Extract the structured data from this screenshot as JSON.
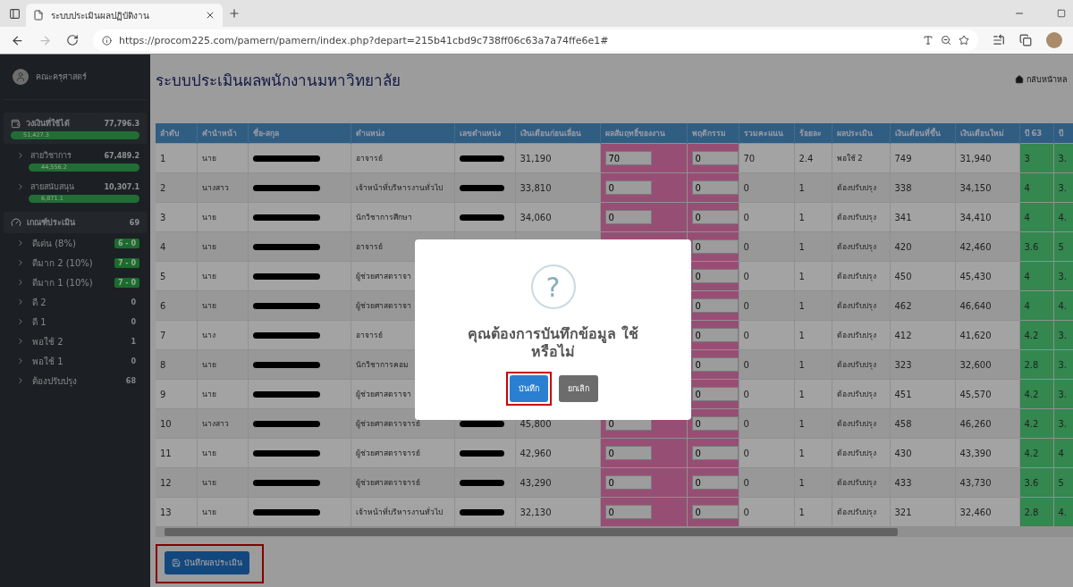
{
  "browser": {
    "tab_title": "ระบบประเมินผลปฏิบัติงาน",
    "url": "https://procom225.com/pamern/pamern/index.php?depart=215b41cbd9c738ff06c63a7a74ffe6e1#"
  },
  "sidebar": {
    "user": "คณะครุศาสตร์",
    "budget": {
      "label": "วงเงินที่ใช้ได้",
      "total": "77,796.3",
      "used": "51,427.3",
      "children": [
        {
          "label": "สายวิชาการ",
          "total": "67,489.2",
          "used": "44,556.2"
        },
        {
          "label": "สายสนับสนุน",
          "total": "10,307.1",
          "used": "6,871.1"
        }
      ]
    },
    "criteria": {
      "label": "เกณฑ์ประเมิน",
      "count": "69",
      "items": [
        {
          "label": "ดีเด่น (8%)",
          "count": "6 - 0",
          "kind": "badge"
        },
        {
          "label": "ดีมาก 2 (10%)",
          "count": "7 - 0",
          "kind": "badge"
        },
        {
          "label": "ดีมาก 1 (10%)",
          "count": "7 - 0",
          "kind": "badge"
        },
        {
          "label": "ดี 2",
          "count": "0",
          "kind": "plain"
        },
        {
          "label": "ดี 1",
          "count": "0",
          "kind": "plain"
        },
        {
          "label": "พอใช้ 2",
          "count": "1",
          "kind": "plain"
        },
        {
          "label": "พอใช้ 1",
          "count": "0",
          "kind": "plain"
        },
        {
          "label": "ต้องปรับปรุง",
          "count": "68",
          "kind": "plain"
        }
      ]
    }
  },
  "header": {
    "title": "ระบบประเมินผลพนักงานมหาวิทยาลัย",
    "back_link": "กลับหน้าหล"
  },
  "table": {
    "columns": [
      {
        "label": "ลำดับ",
        "kind": "text"
      },
      {
        "label": "คำนำหน้า",
        "kind": "text"
      },
      {
        "label": "ชื่อ-สกุล",
        "kind": "redacted"
      },
      {
        "label": "ตำแหน่ง",
        "kind": "text"
      },
      {
        "label": "เลขตำแหน่ง",
        "kind": "redacted"
      },
      {
        "label": "เงินเดือนก่อนเลื่อน",
        "kind": "text"
      },
      {
        "label": "ผลสัมฤทธิ์ของงาน",
        "kind": "input"
      },
      {
        "label": "พฤติกรรม",
        "kind": "input"
      },
      {
        "label": "รวมคะแนน",
        "kind": "text"
      },
      {
        "label": "ร้อยละ",
        "kind": "text"
      },
      {
        "label": "ผลประเมิน",
        "kind": "text"
      },
      {
        "label": "เงินเดือนที่ขึ้น",
        "kind": "text"
      },
      {
        "label": "เงินเดือนใหม่",
        "kind": "text"
      },
      {
        "label": "ปี 63",
        "kind": "year"
      },
      {
        "label": "ปี",
        "kind": "year"
      }
    ],
    "rows": [
      {
        "cells": [
          "1",
          "นาย",
          true,
          "อาจารย์",
          true,
          "31,190",
          "70",
          "0",
          "70",
          "2.4",
          "พอใช้ 2",
          "749",
          "31,940",
          "3",
          "3."
        ]
      },
      {
        "cells": [
          "2",
          "นางสาว",
          true,
          "เจ้าหน้าที่บริหารงานทั่วไป",
          true,
          "33,810",
          "0",
          "0",
          "0",
          "1",
          "ต้องปรับปรุง",
          "338",
          "34,150",
          "4",
          "3."
        ]
      },
      {
        "cells": [
          "3",
          "นาย",
          true,
          "นักวิชาการศึกษา",
          true,
          "34,060",
          "0",
          "0",
          "0",
          "1",
          "ต้องปรับปรุง",
          "341",
          "34,410",
          "4",
          "4."
        ]
      },
      {
        "cells": [
          "4",
          "นาย",
          true,
          "อาจารย์",
          false,
          null,
          null,
          "0",
          "0",
          "1",
          "ต้องปรับปรุง",
          "420",
          "42,460",
          "3.6",
          "5"
        ]
      },
      {
        "cells": [
          "5",
          "นาย",
          true,
          "ผู้ช่วยศาสตราจา",
          false,
          null,
          null,
          "0",
          "0",
          "1",
          "ต้องปรับปรุง",
          "450",
          "45,430",
          "4",
          "3."
        ]
      },
      {
        "cells": [
          "6",
          "นาย",
          true,
          "ผู้ช่วยศาสตราจา",
          false,
          null,
          null,
          "0",
          "0",
          "1",
          "ต้องปรับปรุง",
          "462",
          "46,640",
          "4",
          "4."
        ]
      },
      {
        "cells": [
          "7",
          "นาง",
          true,
          "อาจารย์",
          false,
          null,
          null,
          "0",
          "0",
          "1",
          "ต้องปรับปรุง",
          "412",
          "41,620",
          "4.2",
          "3."
        ]
      },
      {
        "cells": [
          "8",
          "นาย",
          true,
          "นักวิชาการคอม",
          false,
          null,
          null,
          "0",
          "0",
          "1",
          "ต้องปรับปรุง",
          "323",
          "32,600",
          "2.8",
          "3."
        ]
      },
      {
        "cells": [
          "9",
          "นาย",
          true,
          "ผู้ช่วยศาสตราจา",
          false,
          null,
          null,
          "0",
          "0",
          "1",
          "ต้องปรับปรุง",
          "451",
          "45,570",
          "4.2",
          "3."
        ]
      },
      {
        "cells": [
          "10",
          "นางสาว",
          true,
          "ผู้ช่วยศาสตราจารย์",
          true,
          "45,800",
          "0",
          "0",
          "0",
          "1",
          "ต้องปรับปรุง",
          "458",
          "46,260",
          "4.2",
          "3."
        ]
      },
      {
        "cells": [
          "11",
          "นาย",
          true,
          "ผู้ช่วยศาสตราจารย์",
          true,
          "42,960",
          "0",
          "0",
          "0",
          "1",
          "ต้องปรับปรุง",
          "430",
          "43,390",
          "4.2",
          "4"
        ]
      },
      {
        "cells": [
          "12",
          "นาย",
          true,
          "ผู้ช่วยศาสตราจารย์",
          true,
          "43,290",
          "0",
          "0",
          "0",
          "1",
          "ต้องปรับปรุง",
          "433",
          "43,730",
          "3.6",
          "5"
        ]
      },
      {
        "cells": [
          "13",
          "นาย",
          true,
          "เจ้าหน้าที่บริหารงานทั่วไป",
          true,
          "32,130",
          "0",
          "0",
          "0",
          "1",
          "ต้องปรับปรุง",
          "321",
          "32,460",
          "2.8",
          "4."
        ]
      }
    ]
  },
  "save_button": {
    "label": "บันทึกผลประเมิน",
    "highlighted": true
  },
  "dialog": {
    "icon": "?",
    "message": "คุณต้องการบันทึกข้อมูล ใช้หรือไม่",
    "buttons": [
      {
        "label": "บันทึก",
        "kind": "primary",
        "highlighted": true
      },
      {
        "label": "ยกเลิก",
        "kind": "secondary",
        "highlighted": false
      }
    ]
  }
}
